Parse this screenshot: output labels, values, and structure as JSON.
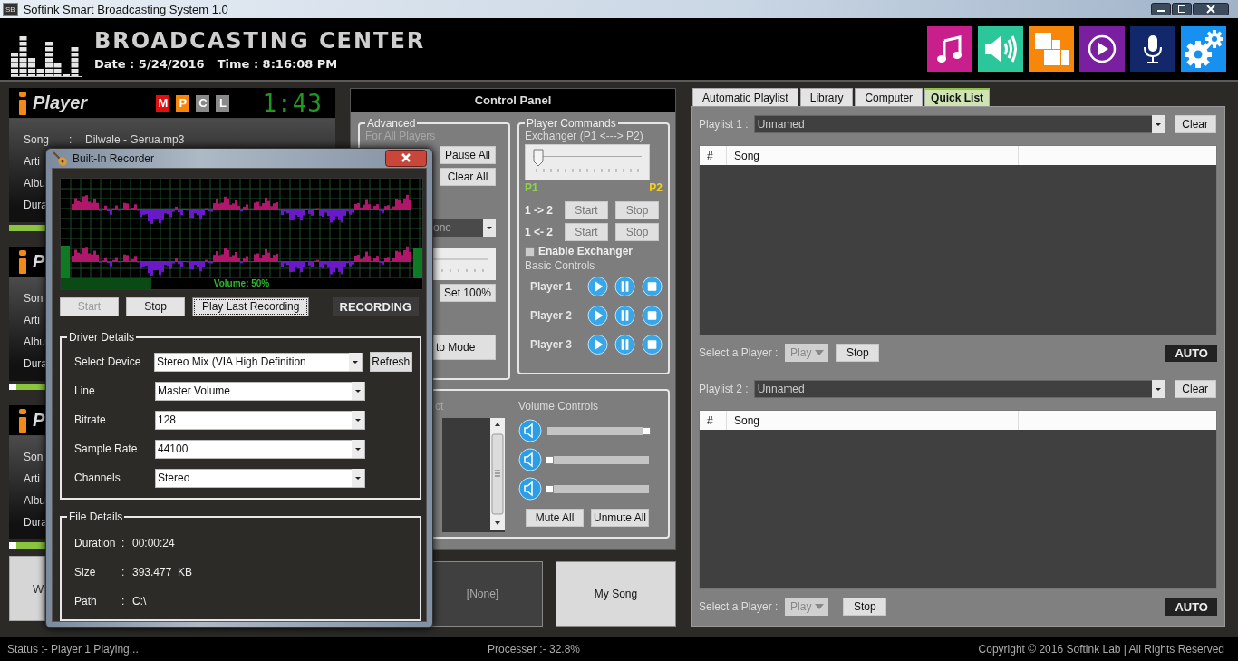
{
  "window": {
    "app_icon": "SB",
    "title": "Softink Smart Broadcasting System 1.0"
  },
  "header": {
    "title": "BROADCASTING CENTER",
    "date": "Date : 5/24/2016",
    "time": "Time : 8:16:08 PM"
  },
  "toolbar": [
    {
      "kind": "music"
    },
    {
      "kind": "speaker"
    },
    {
      "kind": "tiles"
    },
    {
      "kind": "play"
    },
    {
      "kind": "mic"
    },
    {
      "kind": "settings"
    }
  ],
  "players": [
    {
      "title": "Player",
      "badges": [
        {
          "label": "M",
          "color": "#e01010"
        },
        {
          "label": "P",
          "color": "#f7870b"
        },
        {
          "label": "C",
          "color": "#8a8a8a"
        },
        {
          "label": "L",
          "color": "#8a8a8a"
        }
      ],
      "time": "1:43",
      "fields": [
        {
          "label": "Song",
          "separator": ":",
          "value": "Dilwale - Gerua.mp3"
        },
        {
          "label": "Arti"
        },
        {
          "label": "Albu"
        },
        {
          "label": "Dura"
        }
      ]
    },
    {
      "title": "P",
      "fields": [
        {
          "label": "Son"
        },
        {
          "label": "Arti"
        },
        {
          "label": "Albu"
        },
        {
          "label": "Dura"
        }
      ],
      "level": 0
    },
    {
      "title": "P",
      "fields": [
        {
          "label": "Son"
        },
        {
          "label": "Arti"
        },
        {
          "label": "Albu"
        },
        {
          "label": "Dura"
        }
      ],
      "level": 0
    }
  ],
  "left_slot": {
    "label": "W"
  },
  "control_panel": {
    "title": "Control Panel",
    "advanced": {
      "legend": "Advanced",
      "note": "For All Players",
      "pause_all": "Pause All",
      "clear_all": "Clear All",
      "dropdown": "one",
      "set_full": "Set 100%",
      "mode": "to Mode"
    },
    "commands": {
      "legend": "Player Commands",
      "exchanger": "Exchanger (P1 <---> P2)",
      "level": 0,
      "left": "P1",
      "right": "P2",
      "transfers": [
        {
          "label": "1 -> 2",
          "start": "Start",
          "stop": "Stop"
        },
        {
          "label": "1 <- 2",
          "start": "Start",
          "stop": "Stop"
        }
      ],
      "enable": {
        "label": "Enable Exchanger",
        "checked": false
      },
      "basic": "Basic Controls",
      "players": [
        "Player 1",
        "Player 2",
        "Player 3"
      ]
    },
    "mixer": {
      "list_label": "ct",
      "volume_label": "Volume Controls",
      "channels": [
        {
          "level": 1
        },
        {
          "level": 0
        },
        {
          "level": 0
        }
      ],
      "mute_all": "Mute All",
      "unmute_all": "Unmute All"
    },
    "slots": [
      {
        "label": "[None]",
        "loaded": false
      },
      {
        "label": "My Song",
        "loaded": true
      }
    ]
  },
  "library": {
    "tabs": [
      {
        "label": "Automatic Playlist",
        "selected": false
      },
      {
        "label": "Library",
        "selected": false
      },
      {
        "label": "Computer",
        "selected": false
      },
      {
        "label": "Quick List",
        "selected": true
      }
    ],
    "playlists": [
      {
        "label": "Playlist 1 :",
        "name": "Unnamed",
        "clear": "Clear",
        "columns": [
          "#",
          "Song"
        ],
        "player_label": "Select a Player :",
        "player_choice": "Play",
        "stop": "Stop",
        "mode": "AUTO"
      },
      {
        "label": "Playlist 2 :",
        "name": "Unnamed",
        "clear": "Clear",
        "columns": [
          "#",
          "Song"
        ],
        "player_label": "Select a Player :",
        "player_choice": "Play",
        "stop": "Stop",
        "mode": "AUTO"
      }
    ]
  },
  "recorder": {
    "title": "Built-In Recorder",
    "volume": "Volume: 50%",
    "level": 0.25,
    "buttons": [
      {
        "label": "Start",
        "disabled": true,
        "focused": false
      },
      {
        "label": "Stop",
        "disabled": false,
        "focused": false
      },
      {
        "label": "Play Last Recording",
        "disabled": false,
        "focused": true
      }
    ],
    "state": "RECORDING",
    "driver": {
      "legend": "Driver Details",
      "refresh": "Refresh",
      "fields": [
        {
          "label": "Select Device",
          "value": "Stereo Mix (VIA High Definition"
        },
        {
          "label": "Line",
          "value": "Master Volume"
        },
        {
          "label": "Bitrate",
          "value": "128"
        },
        {
          "label": "Sample Rate",
          "value": "44100"
        },
        {
          "label": "Channels",
          "value": "Stereo"
        }
      ]
    },
    "file": {
      "legend": "File Details",
      "rows": [
        {
          "label": "Duration",
          "separator": ":",
          "value": "00:00:24"
        },
        {
          "label": "Size",
          "separator": ":",
          "value": "393.477  KB"
        },
        {
          "label": "Path",
          "separator": ":",
          "value": "C:\\"
        }
      ]
    }
  },
  "status_bar": {
    "status": "Status :- Player 1 Playing...",
    "processor": "Processer :- 32.8%",
    "copyright": "Copyright © 2016 Softink Lab | All Rights Reserved"
  }
}
